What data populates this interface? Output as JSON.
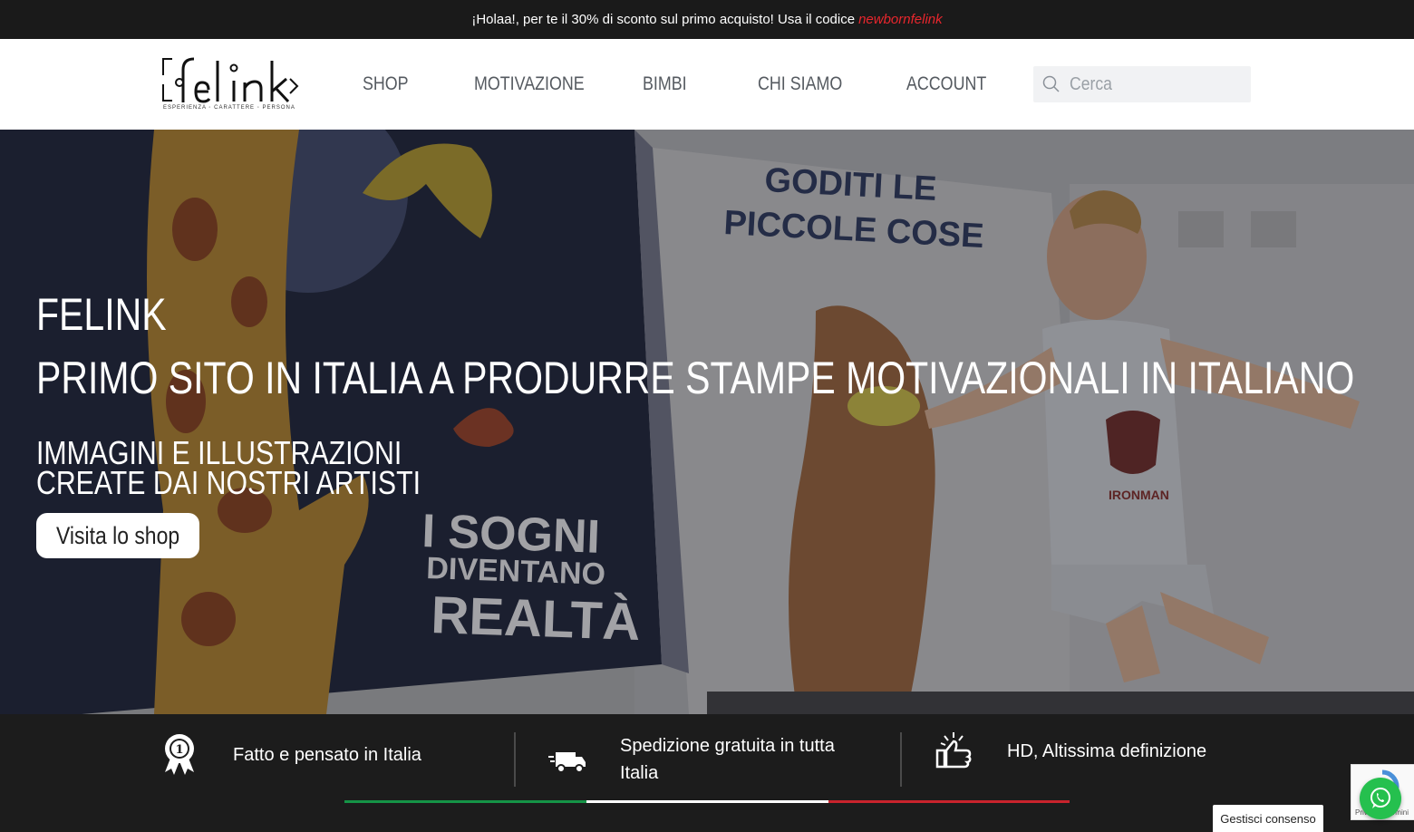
{
  "promo": {
    "text": "¡Holaa!, per te il 30% di sconto sul primo acquisto! Usa il codice",
    "code": "newbornfelink"
  },
  "logo": {
    "name": "felink",
    "tagline": "ESPERIENZA  ◦  CARATTERE  ◦  PERSONA"
  },
  "nav": {
    "items": [
      {
        "label": "SHOP"
      },
      {
        "label": "MOTIVAZIONE"
      },
      {
        "label": "BIMBI"
      },
      {
        "label": "CHI SIAMO"
      },
      {
        "label": "ACCOUNT"
      }
    ]
  },
  "search": {
    "placeholder": "Cerca"
  },
  "hero": {
    "title": "FELINK",
    "subtitle": "PRIMO SITO IN ITALIA A PRODURRE STAMPE MOTIVAZIONALI IN ITALIANO",
    "line1": "IMMAGINI E ILLUSTRAZIONI",
    "line2": "CREATE DAI NOSTRI ARTISTI",
    "cta": "Visita lo shop",
    "wall_text_1": "GODITI LE",
    "wall_text_2": "PICCOLE COSE",
    "canvas_text_1": "I SOGNI",
    "canvas_text_2": "DIVENTANO",
    "canvas_text_3": "REALTÀ",
    "shirt_text": "IRONMAN"
  },
  "features": [
    {
      "icon": "award-ribbon-icon",
      "label": "Fatto e pensato in Italia"
    },
    {
      "icon": "delivery-truck-icon",
      "label": "Spedizione gratuita in tutta Italia"
    },
    {
      "icon": "thumbs-up-icon",
      "label": "HD, Altissima definizione"
    }
  ],
  "flag_colors": [
    "#159447",
    "#ffffff",
    "#c8232c"
  ],
  "consent": {
    "label": "Gestisci consenso"
  },
  "recaptcha": {
    "label": "Privacy - Termini"
  },
  "colors": {
    "promo_code": "#e8262d",
    "whatsapp": "#25c04e"
  }
}
